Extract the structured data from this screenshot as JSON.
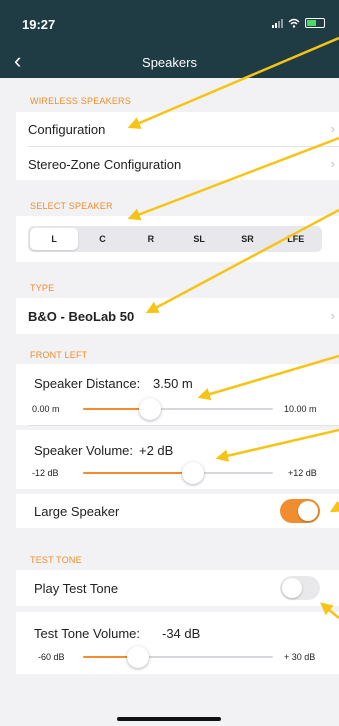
{
  "status_bar": {
    "time": "19:27"
  },
  "nav": {
    "title": "Speakers"
  },
  "wireless_speakers": {
    "header": "WIRELESS SPEAKERS",
    "items": [
      {
        "label": "Configuration"
      },
      {
        "label": "Stereo-Zone Configuration"
      }
    ]
  },
  "select_speaker": {
    "header": "SELECT SPEAKER",
    "options": [
      "L",
      "C",
      "R",
      "SL",
      "SR",
      "LFE"
    ],
    "selected": "L"
  },
  "type": {
    "header": "TYPE",
    "value": "B&O - BeoLab 50"
  },
  "front_left": {
    "header": "FRONT LEFT",
    "distance": {
      "label": "Speaker Distance:",
      "value": "3.50 m",
      "min": "0.00 m",
      "max": "10.00 m",
      "fraction": 0.35
    },
    "volume": {
      "label": "Speaker Volume:",
      "value": "+2 dB",
      "min": "-12 dB",
      "max": "+12 dB",
      "fraction": 0.58
    },
    "large_speaker": {
      "label": "Large Speaker",
      "on": true
    }
  },
  "test_tone": {
    "header": "TEST TONE",
    "play": {
      "label": "Play Test Tone",
      "on": false
    },
    "volume": {
      "label": "Test Tone Volume:",
      "value": "-34 dB",
      "min": "-60 dB",
      "max": "+ 30 dB",
      "fraction": 0.29
    }
  },
  "colors": {
    "accent": "#f08d2e",
    "nav_bg": "#1f3b44",
    "annotation": "#f7c416"
  }
}
